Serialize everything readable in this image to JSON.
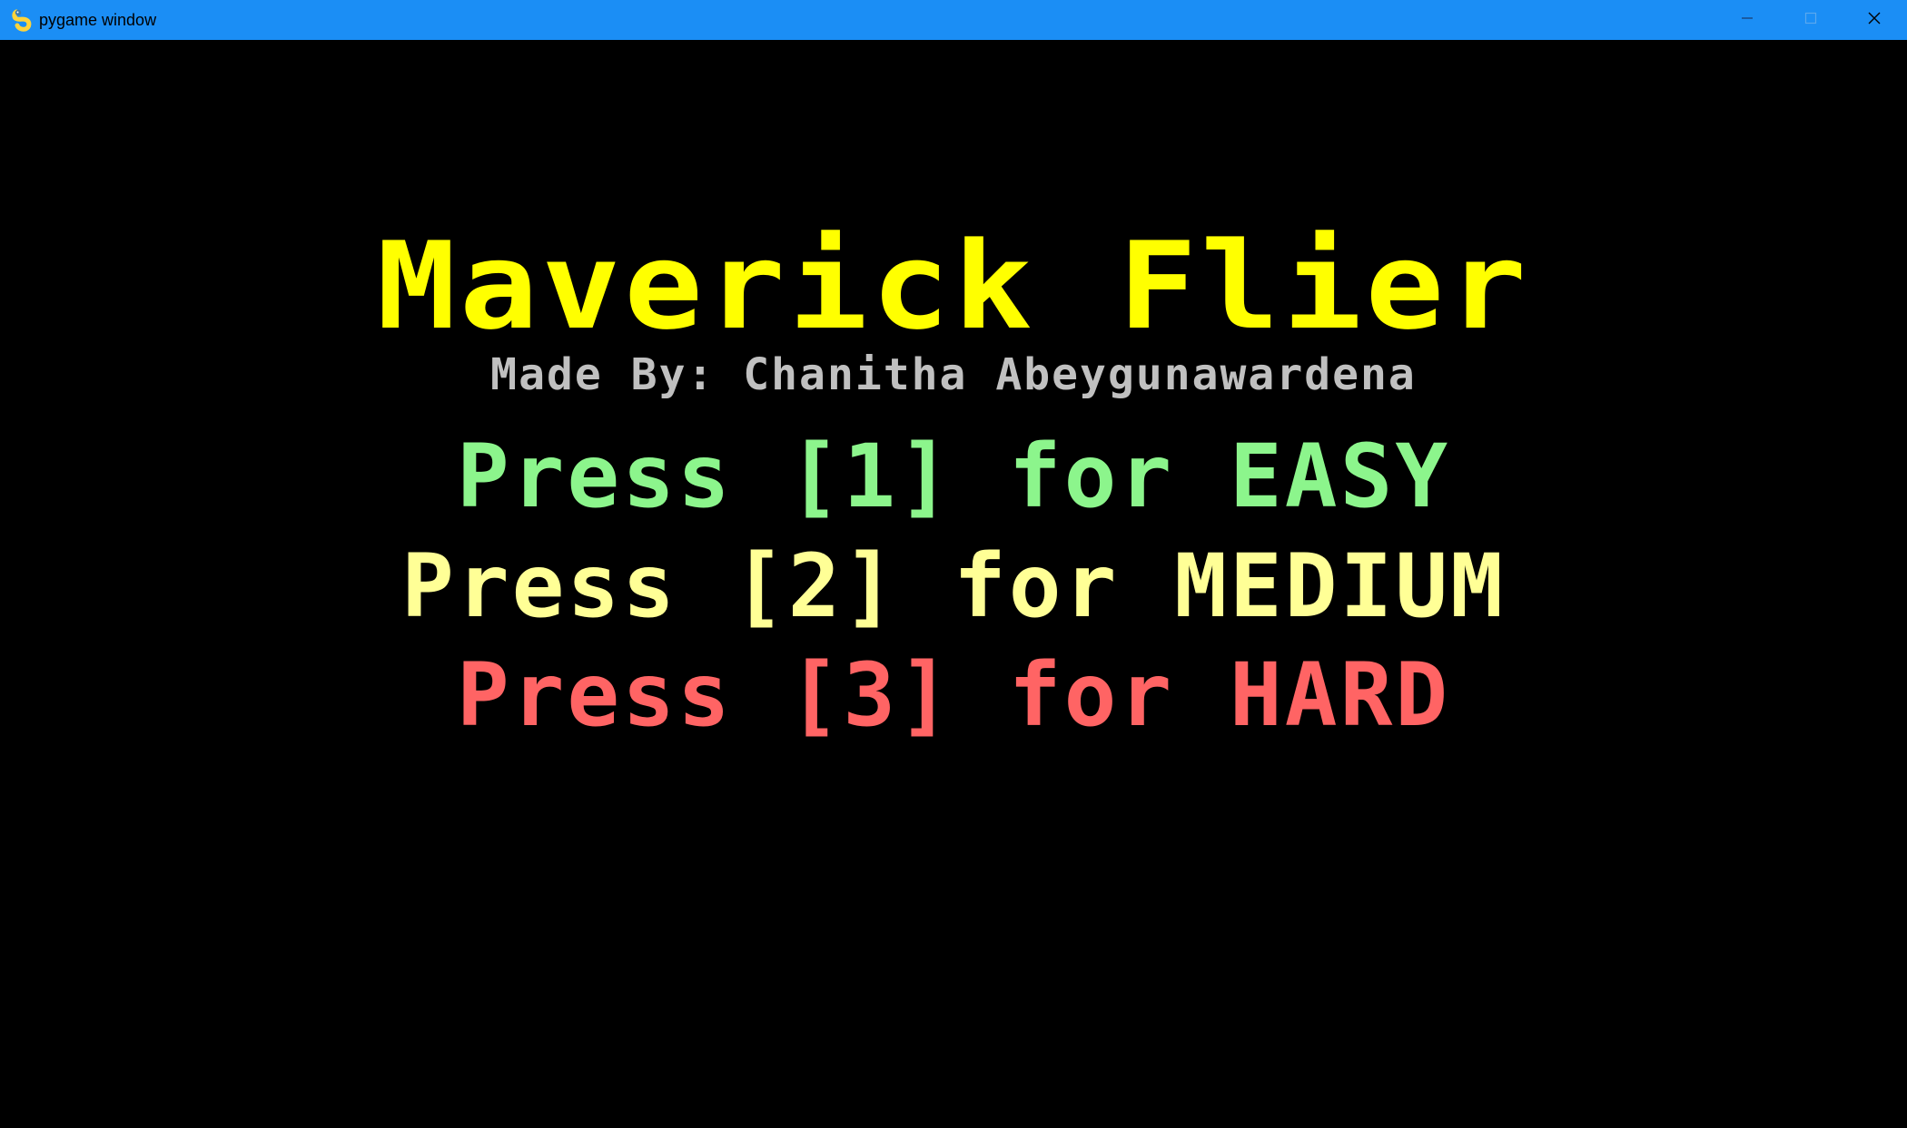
{
  "window": {
    "title": "pygame window",
    "titlebar_color": "#1b8ef5",
    "icons": [
      "pygame-snake-icon",
      "minimize-icon",
      "maximize-icon",
      "close-icon"
    ]
  },
  "menu": {
    "title": "Maverick Flier",
    "credit": "Made By: Chanitha Abeygunawardena",
    "options": [
      {
        "label": "Press [1] for EASY",
        "color": "#8cf58c"
      },
      {
        "label": "Press [2] for MEDIUM",
        "color": "#ffff96"
      },
      {
        "label": "Press [3] for HARD",
        "color": "#ff6464"
      }
    ],
    "title_color": "#ffff00",
    "credit_color": "#c0c0c0",
    "background": "#000000"
  }
}
